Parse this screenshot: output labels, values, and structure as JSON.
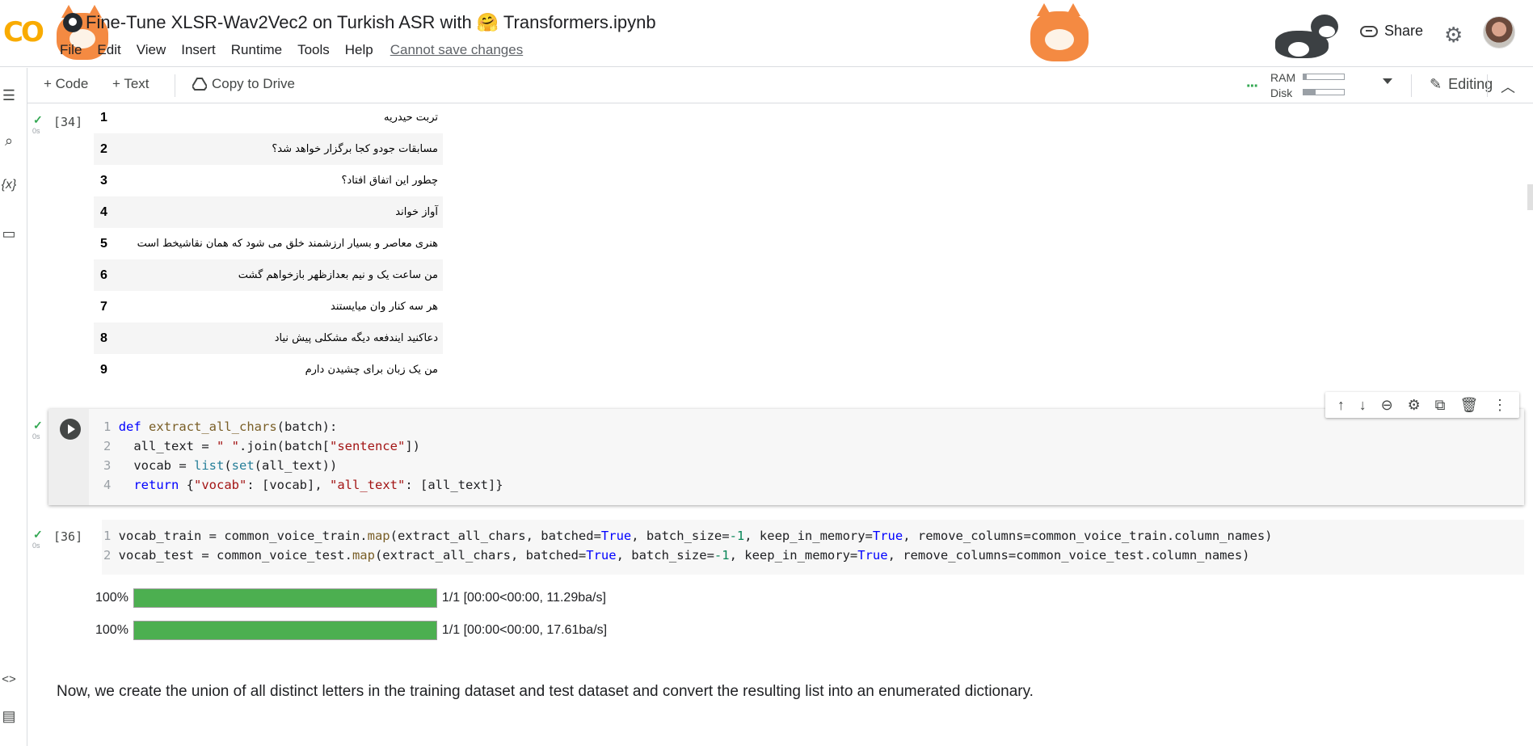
{
  "app": {
    "logo_text": "CO",
    "notebook_title": "Fine-Tune XLSR-Wav2Vec2 on Turkish ASR with 🤗 Transformers.ipynb",
    "share_label": "Share",
    "icons": [
      "github-icon",
      "share-lock-icon",
      "gear-icon",
      "avatar"
    ]
  },
  "menu": {
    "items": [
      "File",
      "Edit",
      "View",
      "Insert",
      "Runtime",
      "Tools",
      "Help"
    ],
    "cannot_save": "Cannot save changes"
  },
  "toolbar": {
    "code_label": "+ Code",
    "text_label": "+ Text",
    "copy_label": "Copy to Drive",
    "ram_label": "RAM",
    "disk_label": "Disk",
    "ram_level": 0.08,
    "disk_level": 0.3,
    "editing_label": "Editing",
    "connected_color": "#34a853"
  },
  "cells": {
    "table_cell": {
      "exec_count": "[34]",
      "elapsed": "0s",
      "rows": [
        {
          "index": "1",
          "text": "تربت حیدریه"
        },
        {
          "index": "2",
          "text": "مسابقات جودو کجا برگزار خواهد شد؟"
        },
        {
          "index": "3",
          "text": "چطور این اتفاق افتاد؟"
        },
        {
          "index": "4",
          "text": "آواز خواند"
        },
        {
          "index": "5",
          "text": "هنری معاصر و بسیار ارزشمند خلق می شود که همان نقاشیخط است"
        },
        {
          "index": "6",
          "text": "من ساعت یک و نیم بعدازظهر بازخواهم گشت"
        },
        {
          "index": "7",
          "text": "هر سه کنار وان میایستند"
        },
        {
          "index": "8",
          "text": "دعاکنید ایندفعه دیگه مشکلی پیش نیاد"
        },
        {
          "index": "9",
          "text": "من یک زبان برای چشیدن دارم"
        }
      ]
    },
    "def_cell": {
      "elapsed": "0s",
      "line_numbers": [
        "1",
        "2",
        "3",
        "4"
      ]
    },
    "map_cell": {
      "exec_count": "[36]",
      "elapsed": "0s",
      "line_numbers": [
        "1",
        "2"
      ]
    },
    "progress": [
      {
        "percent_label": "100%",
        "fraction": 1.0,
        "stats": "1/1 [00:00<00:00, 11.29ba/s]"
      },
      {
        "percent_label": "100%",
        "fraction": 1.0,
        "stats": "1/1 [00:00<00:00, 17.61ba/s]"
      }
    ],
    "text_cell": {
      "text": "Now, we create the union of all distinct letters in the training dataset and test dataset and convert the resulting list into an enumerated dictionary."
    }
  }
}
